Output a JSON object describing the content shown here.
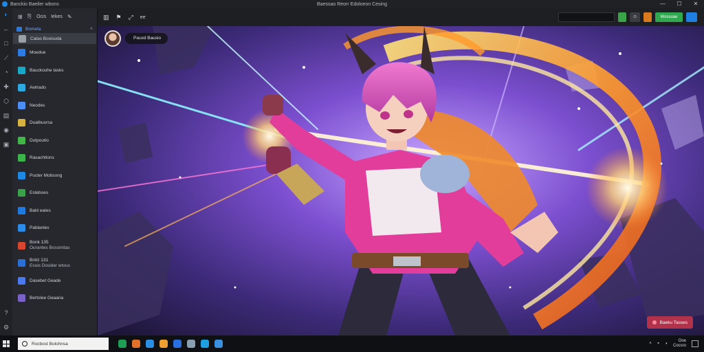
{
  "window": {
    "title_left": "Banckio Baeiler wbons",
    "title_center": "Baessao Reorr Edoloeon Cesing",
    "controls": [
      "—",
      "☐",
      "✕"
    ]
  },
  "sidebar_top": {
    "items": [
      "Ocis",
      "Iekes"
    ]
  },
  "sidebar": {
    "header": "Bometa",
    "items": [
      {
        "label": "Catas Bosisuda",
        "color": "#9aa0a8"
      },
      {
        "label": "Moedue",
        "color": "#2c7be5"
      },
      {
        "label": "Bauckouhe tasks",
        "color": "#19a7c7"
      },
      {
        "label": "Awtrado",
        "color": "#2da8e0"
      },
      {
        "label": "Neodes",
        "color": "#4c8df6"
      },
      {
        "label": "Dualbuorsa",
        "color": "#d6b341"
      },
      {
        "label": "Dutpoutio",
        "color": "#43b649"
      },
      {
        "label": "Rasachtlons",
        "color": "#3bb54a"
      },
      {
        "label": "Pucter Mobsong",
        "color": "#1e88e5"
      },
      {
        "label": "Esteboes",
        "color": "#3aa34a"
      },
      {
        "label": "Bald eates",
        "color": "#1f7ae0"
      },
      {
        "label": "Pablanles",
        "color": "#2b8be6"
      },
      {
        "label": "Bonk 135",
        "sub": "Ourantes Bossmitas",
        "color": "#d9462f"
      },
      {
        "label": "Bnitz 131",
        "sub": "Evuis Dosider wtous",
        "color": "#2b6fd6"
      },
      {
        "label": "Dasebet Geade",
        "color": "#4a79f0"
      },
      {
        "label": "Bertolee Geaaria",
        "color": "#7a62c9"
      }
    ]
  },
  "toolbar": {
    "labels": [
      "ee"
    ],
    "cta": "Wossuae"
  },
  "user": {
    "name": "Pauxd Bausio"
  },
  "float_button": {
    "label": "Baeku Tasses"
  },
  "taskbar": {
    "search_placeholder": "Rocbost Bolohnsa",
    "pins": [
      "#1f9d55",
      "#e0702a",
      "#2a8fe0",
      "#f0a030",
      "#2a6fe0",
      "#8aa0b0",
      "#1ea0e0",
      "#3a8fe0"
    ],
    "clock_time": "Ooe",
    "clock_date": "Cocsro"
  }
}
